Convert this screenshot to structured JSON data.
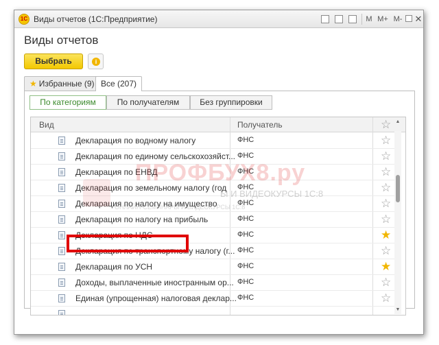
{
  "window": {
    "title": "Виды отчетов (1С:Предприятие)",
    "controls": [
      "M",
      "M+",
      "M-"
    ]
  },
  "page": {
    "title": "Виды отчетов",
    "select_button": "Выбрать"
  },
  "tabs": [
    {
      "label": "Избранные (9)",
      "icon": "star-icon"
    },
    {
      "label": "Все (207)"
    }
  ],
  "grouping": [
    "По категориям",
    "По получателям",
    "Без группировки"
  ],
  "grid": {
    "columns": {
      "vid": "Вид",
      "recipient": "Получатель"
    },
    "rows": [
      {
        "name": "Декларация по водному налогу",
        "recipient": "ФНС",
        "favorite": false
      },
      {
        "name": "Декларация по единому сельскохозяйст...",
        "recipient": "ФНС",
        "favorite": false
      },
      {
        "name": "Декларация по ЕНВД",
        "recipient": "ФНС",
        "favorite": false
      },
      {
        "name": "Декларация по земельному налогу (год",
        "recipient": "ФНС",
        "favorite": false
      },
      {
        "name": "Декларация по налогу на имущество",
        "recipient": "ФНС",
        "favorite": false
      },
      {
        "name": "Декларация по налогу на прибыль",
        "recipient": "ФНС",
        "favorite": false
      },
      {
        "name": "Декларация по НДС",
        "recipient": "ФНС",
        "favorite": true
      },
      {
        "name": "Декларация по транспортному налогу (г...",
        "recipient": "ФНС",
        "favorite": false
      },
      {
        "name": "Декларация по УСН",
        "recipient": "ФНС",
        "favorite": true
      },
      {
        "name": "Доходы, выплаченные иностранным ор...",
        "recipient": "ФНС",
        "favorite": false
      },
      {
        "name": "Единая (упрощенная) налоговая деклар...",
        "recipient": "ФНС",
        "favorite": false
      }
    ]
  },
  "watermark": {
    "brand": "ПРОФБУХ8.ру",
    "tagline": "Ы И ВИДЕОКУРСЫ 1С:8",
    "subline": "ОНЛАЙН-СЕМИНАРЫ И ВИДЕОКУРСЫ 1С:8"
  },
  "colors": {
    "accent_yellow": "#f3c800",
    "active_group_text": "#3b8a2c",
    "favorite_star": "#f1b600",
    "highlight_red": "#e00000"
  }
}
